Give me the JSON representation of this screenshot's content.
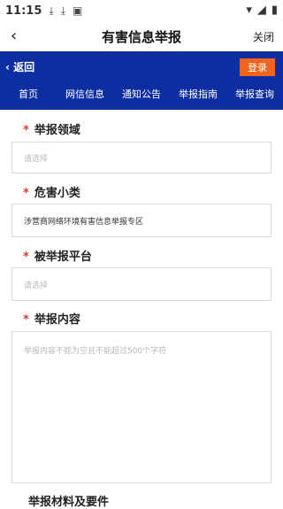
{
  "status": {
    "time": "11:15"
  },
  "titlebar": {
    "title": "有害信息举报",
    "close_label": "关闭"
  },
  "bluebar": {
    "back_label": "返回",
    "login_label": "登录",
    "nav": [
      "首页",
      "网信信息",
      "通知公告",
      "举报指南",
      "举报查询"
    ]
  },
  "form": {
    "domain": {
      "label": "举报领域",
      "placeholder": "请选择"
    },
    "category": {
      "label": "危害小类",
      "value": "涉营商网络环境有害信息举报专区"
    },
    "platform": {
      "label": "被举报平台",
      "placeholder": "请选择"
    },
    "content": {
      "label": "举报内容",
      "placeholder": "举报内容不能为空且不能超过500个字符"
    },
    "materials_label": "举报材料及要件"
  }
}
